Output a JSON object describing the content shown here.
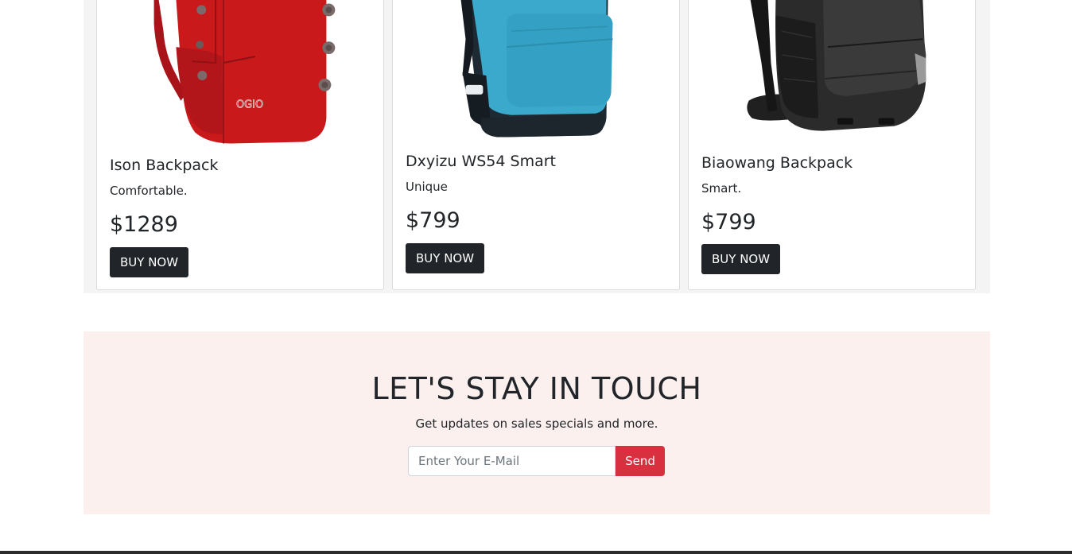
{
  "products": [
    {
      "name": "Ison Backpack",
      "description": "Comfortable.",
      "price": "$1289",
      "button_label": "BUY NOW",
      "color": "#c9191b",
      "image_icon": "red-backpack-image",
      "brand_logo": "OGIO"
    },
    {
      "name": "Dxyizu WS54 Smart",
      "description": "Unique",
      "price": "$799",
      "button_label": "BUY NOW",
      "color": "#3aa9cc",
      "image_icon": "blue-backpack-image"
    },
    {
      "name": "Biaowang Backpack",
      "description": "Smart.",
      "price": "$799",
      "button_label": "BUY NOW",
      "color": "#2b2b2b",
      "image_icon": "black-backpack-image"
    }
  ],
  "newsletter": {
    "title": "LET'S STAY IN TOUCH",
    "subtitle": "Get updates on sales specials and more.",
    "email_placeholder": "Enter Your E-Mail",
    "email_value": "",
    "send_label": "Send"
  },
  "colors": {
    "button_dark": "#212529",
    "send_red": "#d9303f",
    "newsletter_bg": "#fcf0ef",
    "products_bg": "#f4f4f4"
  }
}
